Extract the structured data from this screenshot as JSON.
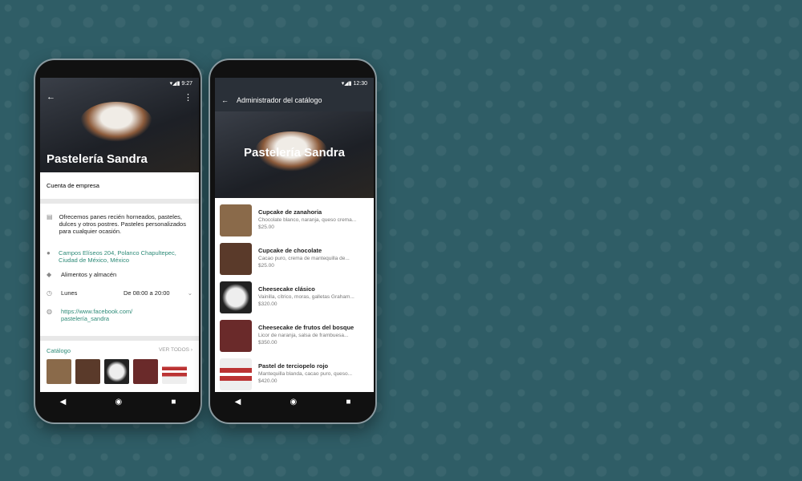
{
  "phone1": {
    "time": "9:27",
    "business_name": "Pastelería Sandra",
    "account_type": "Cuenta de empresa",
    "description": "Ofrecemos panes recién horneados, pasteles, dulces y otros postres. Pasteles personalizados para cualquier ocasión.",
    "address": "Campos Elíseos 204, Polanco Chapultepec, Ciudad de México, México",
    "category": "Alimentos y almacén",
    "day": "Lunes",
    "hours": "De 08:00 a 20:00",
    "website": "https://www.facebook.com/ pastelería_sandra",
    "catalog_label": "Catálogo",
    "see_all": "VER TODOS"
  },
  "phone2": {
    "time": "12:30",
    "title": "Administrador del catálogo",
    "business_name": "Pastelería Sandra",
    "items": [
      {
        "name": "Cupcake de zanahoria",
        "desc": "Chocolate blanco, naranja, queso crema...",
        "price": "$25.00"
      },
      {
        "name": "Cupcake de chocolate",
        "desc": "Cacao puro, crema de mantequilla de...",
        "price": "$25.00"
      },
      {
        "name": "Cheesecake clásico",
        "desc": "Vainilla, cítrico, moras, galletas Graham...",
        "price": "$320.00"
      },
      {
        "name": "Cheesecake de frutos del bosque",
        "desc": "Licor de naranja, salsa de frambuesa...",
        "price": "$350.00"
      },
      {
        "name": "Pastel de terciopelo rojo",
        "desc": "Mantequilla blanda, cacao puro, queso...",
        "price": "$420.00"
      }
    ]
  },
  "colors": {
    "background": "#2f5d66",
    "accent": "#2e8b78"
  }
}
